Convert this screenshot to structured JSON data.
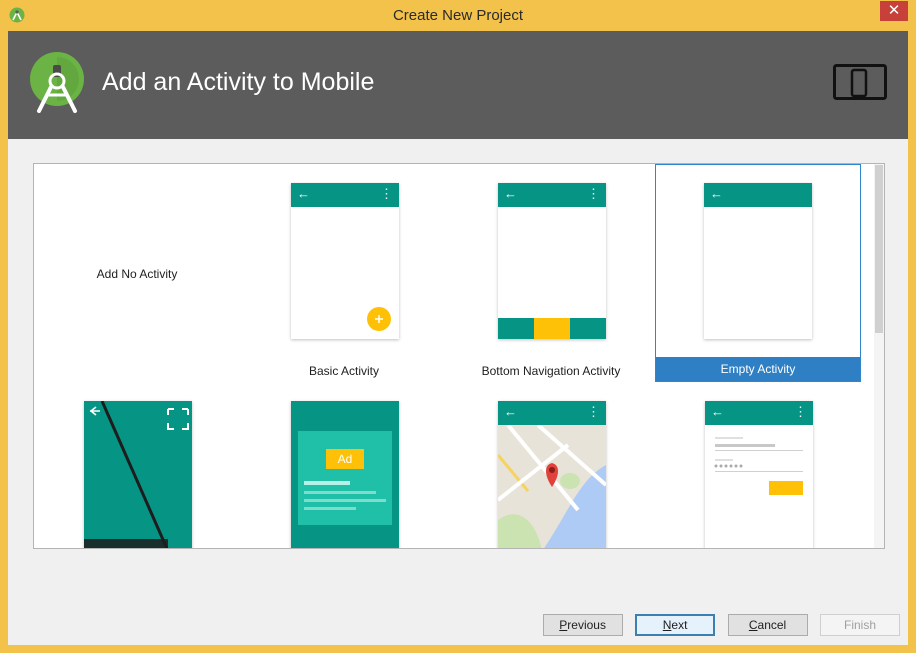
{
  "window": {
    "title": "Create New Project",
    "close_symbol": "✕",
    "title_bar_color": "#F3C24A"
  },
  "banner": {
    "title": "Add an Activity to Mobile",
    "logo": "android-studio-icon",
    "device": "phone-tablet-icon",
    "background": "#5C5C5C"
  },
  "gallery": {
    "items": [
      {
        "label": "Add No Activity",
        "selected": false
      },
      {
        "label": "Basic Activity",
        "selected": false
      },
      {
        "label": "Bottom Navigation Activity",
        "selected": false
      },
      {
        "label": "Empty Activity",
        "selected": true
      },
      {
        "label": "",
        "selected": false
      },
      {
        "label": "",
        "selected": false
      },
      {
        "label": "",
        "selected": false
      },
      {
        "label": "",
        "selected": false
      }
    ],
    "icons": {
      "back": "←",
      "menu": "⋮",
      "fab": "+",
      "ad": "Ad"
    },
    "accent": "#069485",
    "fab_color": "#FFC107",
    "selection_color": "#2F7FC4"
  },
  "buttons": {
    "previous": {
      "mnemonic": "P",
      "rest": "revious"
    },
    "next": {
      "mnemonic": "N",
      "rest": "ext"
    },
    "cancel": {
      "mnemonic": "C",
      "rest": "ancel"
    },
    "finish": {
      "label": "Finish",
      "enabled": false
    }
  }
}
